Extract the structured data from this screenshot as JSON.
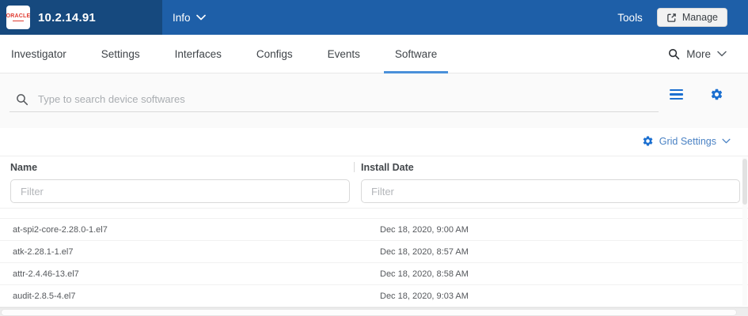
{
  "device": {
    "ip": "10.2.14.91",
    "logo_text": "ORACLE"
  },
  "topbar": {
    "info_label": "Info",
    "tools_label": "Tools",
    "manage_label": "Manage"
  },
  "tabs": {
    "items": [
      {
        "label": "Investigator",
        "active": false
      },
      {
        "label": "Settings",
        "active": false
      },
      {
        "label": "Interfaces",
        "active": false
      },
      {
        "label": "Configs",
        "active": false
      },
      {
        "label": "Events",
        "active": false
      },
      {
        "label": "Software",
        "active": true
      }
    ],
    "more_label": "More"
  },
  "search": {
    "placeholder": "Type to search device softwares"
  },
  "grid": {
    "settings_label": "Grid Settings"
  },
  "table": {
    "columns": [
      {
        "label": "Name",
        "filter_placeholder": "Filter"
      },
      {
        "label": "Install Date",
        "filter_placeholder": "Filter"
      }
    ],
    "rows": [
      {
        "name": "at-spi2-core-2.28.0-1.el7",
        "install_date": "Dec 18, 2020, 9:00 AM"
      },
      {
        "name": "atk-2.28.1-1.el7",
        "install_date": "Dec 18, 2020, 8:57 AM"
      },
      {
        "name": "attr-2.4.46-13.el7",
        "install_date": "Dec 18, 2020, 8:58 AM"
      },
      {
        "name": "audit-2.8.5-4.el7",
        "install_date": "Dec 18, 2020, 9:03 AM"
      }
    ]
  },
  "icons": {
    "search": "magnifier",
    "chevron_down": "chevron-v",
    "manage": "open-in-new-arrow",
    "menu": "hamburger-lines",
    "gear": "settings-cog"
  },
  "colors": {
    "topbar_dark": "#16497E",
    "topbar_main": "#1E5FA8",
    "active_tab_underline": "#4A90D9",
    "icon_blue": "#1B6FD0",
    "link_blue": "#4A82C4",
    "logo_red": "#E03C31"
  }
}
